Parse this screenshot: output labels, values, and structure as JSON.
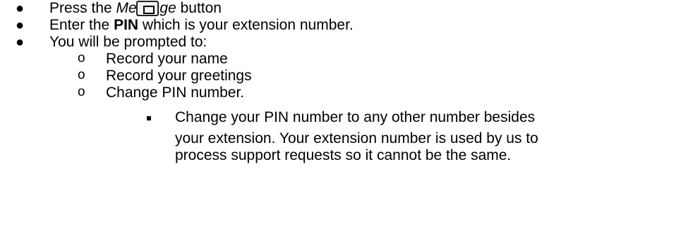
{
  "bullets": {
    "b1_prefix": "Press the ",
    "b1_italic": "Message",
    "b1_suffix": " button",
    "b2_prefix": "Enter the ",
    "b2_bold": "PIN",
    "b2_suffix": " which is your extension number.",
    "b3": "You will be prompted to:"
  },
  "sub_items": [
    "Record your name",
    "Record your greetings",
    "Change PIN number."
  ],
  "note_lines": [
    "Change your PIN number to any other number besides",
    "your extension.  Your extension number is used by us to",
    "process support requests so it cannot be the same."
  ],
  "icons": {
    "bullet_glyph": "●",
    "sub_glyph": "o",
    "message_button_icon": "envelope-icon"
  }
}
